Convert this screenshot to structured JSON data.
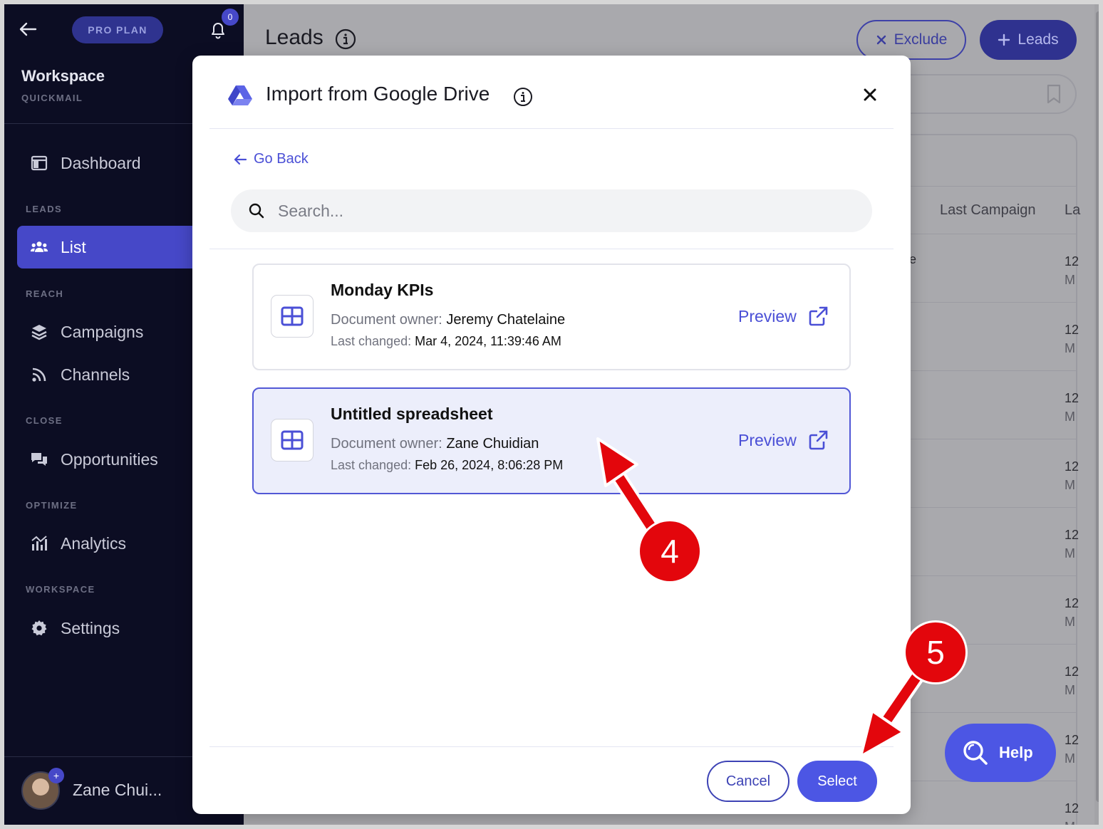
{
  "sidebar": {
    "plan_badge": "PRO PLAN",
    "notification_count": "0",
    "workspace_name": "Workspace",
    "workspace_sub": "QUICKMAIL",
    "dashboard": "Dashboard",
    "sections": {
      "leads": "LEADS",
      "reach": "REACH",
      "close": "CLOSE",
      "optimize": "OPTIMIZE",
      "workspace": "WORKSPACE"
    },
    "items": {
      "list": "List",
      "campaigns": "Campaigns",
      "channels": "Channels",
      "opportunities": "Opportunities",
      "analytics": "Analytics",
      "settings": "Settings"
    },
    "avatar_plus": "+",
    "user_name": "Zane Chui..."
  },
  "page": {
    "title": "Leads",
    "exclude_label": "Exclude",
    "add_leads_label": "Leads",
    "col_last_campaign": "Last Campaign",
    "col_truncated": "La",
    "truncated_cell": "e",
    "rows": [
      {
        "a": "12",
        "b": "M"
      },
      {
        "a": "12",
        "b": "M"
      },
      {
        "a": "12",
        "b": "M"
      },
      {
        "a": "12",
        "b": "M"
      },
      {
        "a": "12",
        "b": "M"
      },
      {
        "a": "12",
        "b": "M"
      },
      {
        "a": "12",
        "b": "M"
      },
      {
        "a": "12",
        "b": "M"
      },
      {
        "a": "12",
        "b": "M"
      }
    ]
  },
  "modal": {
    "title": "Import from Google Drive",
    "go_back": "Go Back",
    "search_placeholder": "Search...",
    "owner_label": "Document owner:",
    "changed_label": "Last changed:",
    "preview_label": "Preview",
    "documents": [
      {
        "name": "Monday KPIs",
        "owner": "Jeremy Chatelaine",
        "changed": "Mar 4, 2024, 11:39:46 AM",
        "selected": false
      },
      {
        "name": "Untitled spreadsheet",
        "owner": "Zane Chuidian",
        "changed": "Feb 26, 2024, 8:06:28 PM",
        "selected": true
      }
    ],
    "cancel_label": "Cancel",
    "select_label": "Select"
  },
  "help": {
    "label": "Help"
  },
  "annotations": {
    "step4": "4",
    "step5": "5"
  },
  "colors": {
    "accent": "#4c56e4",
    "sidebar_bg": "#0c0d23",
    "annotation": "#e3060c",
    "selected_card": "#eceefb"
  }
}
